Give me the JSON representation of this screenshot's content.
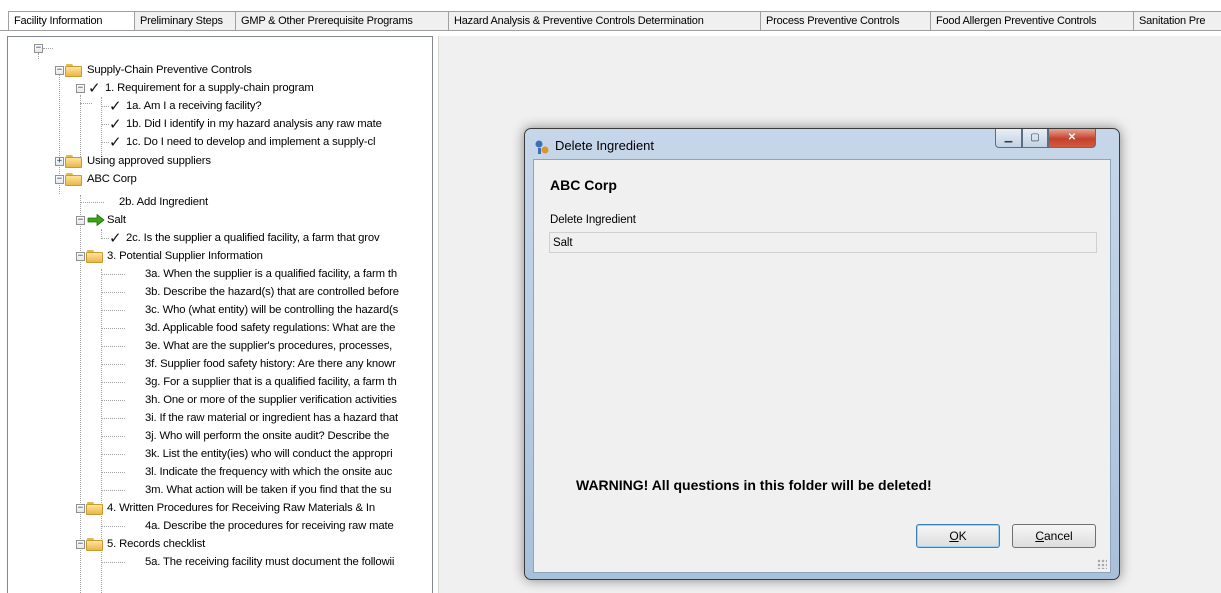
{
  "tabs": [
    "Facility Information",
    "Preliminary Steps",
    "GMP & Other Prerequisite Programs",
    "Hazard Analysis & Preventive Controls Determination",
    "Process Preventive Controls",
    "Food Allergen Preventive Controls",
    "Sanitation Pre"
  ],
  "tree": {
    "items": [
      "Supply-Chain Preventive Controls",
      "1. Requirement for a supply-chain program",
      "1a. Am I a receiving facility?",
      "1b. Did I identify in my hazard analysis any raw mate",
      "1c. Do I need to develop and implement a supply-cl",
      "Using approved suppliers",
      "ABC Corp",
      "2b. Add Ingredient",
      "Salt",
      "2c. Is the supplier a qualified facility, a farm that grov",
      "3. Potential Supplier Information",
      "3a. When the supplier is a qualified facility, a farm th",
      "3b. Describe the hazard(s) that are controlled before",
      "3c. Who (what entity) will be controlling the hazard(s",
      "3d. Applicable food safety regulations: What are the",
      "3e. What are the supplier's procedures, processes,",
      "3f. Supplier food safety history: Are there any knowr",
      "3g. For a supplier that is a qualified facility, a farm th",
      "3h. One or more of the supplier verification activities",
      "3i. If the raw material or ingredient has a hazard that",
      "3j. Who will perform the onsite audit?  Describe the",
      "3k. List the entity(ies) who will conduct the appropri",
      "3l. Indicate the frequency with which the onsite auc",
      "3m. What action will be taken if you find that the su",
      "4. Written Procedures for Receiving Raw Materials & In",
      "4a. Describe the procedures for receiving raw mate",
      "5. Records checklist",
      "5a. The receiving facility must document the followii"
    ]
  },
  "dialog": {
    "title": "Delete Ingredient",
    "heading": "ABC Corp",
    "field_label": "Delete Ingredient",
    "field_value": "Salt",
    "warning": "WARNING!  All questions in this folder will be deleted!",
    "ok_label": "K",
    "ok_mnemonic": "O",
    "cancel_mnemonic": "C",
    "cancel_label": "ancel"
  },
  "colors": {
    "arrow": "#3aa516",
    "folder": "#f2c55c",
    "close_button": "#c4412a"
  }
}
